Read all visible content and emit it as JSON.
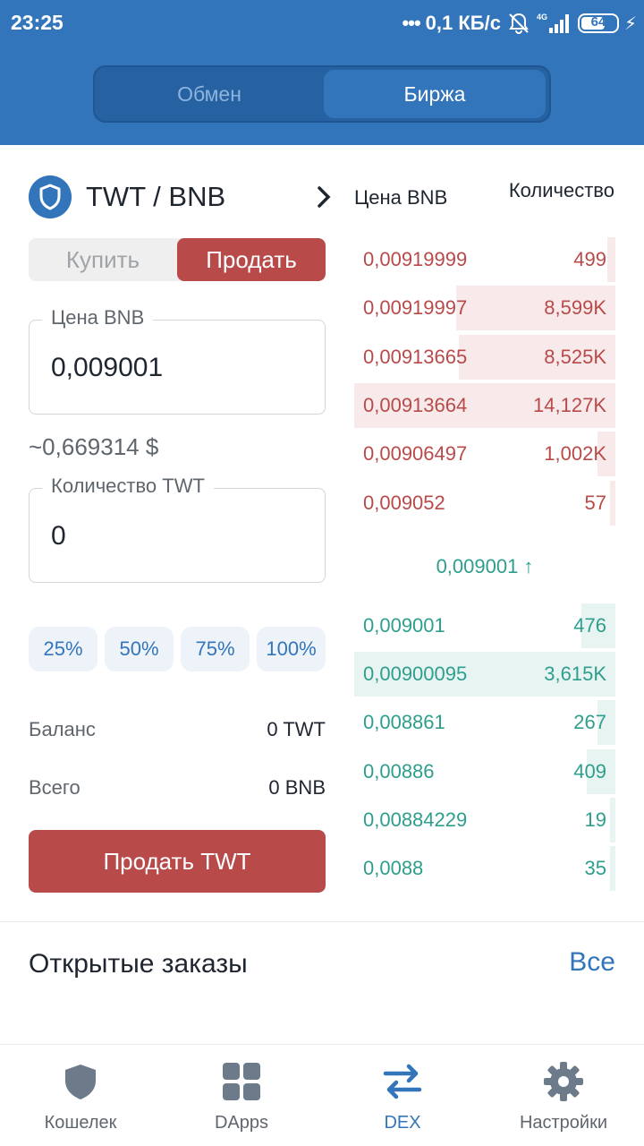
{
  "status_bar": {
    "time": "23:25",
    "network_speed": "0,1 КБ/с",
    "network_type": "4G",
    "battery": "64"
  },
  "header": {
    "tabs": [
      {
        "label": "Обмен",
        "active": false
      },
      {
        "label": "Биржа",
        "active": true
      }
    ]
  },
  "pair": {
    "title": "TWT / BNB",
    "logo_icon": "shield-icon"
  },
  "trade_toggle": {
    "buy_label": "Купить",
    "sell_label": "Продать",
    "selected": "sell"
  },
  "price_field": {
    "label": "Цена BNB",
    "value": "0,009001"
  },
  "usd_estimate": "~0,669314 $",
  "amount_field": {
    "label": "Количество TWT",
    "value": "0"
  },
  "percent_buttons": [
    "25%",
    "50%",
    "75%",
    "100%"
  ],
  "balance": {
    "label": "Баланс",
    "value": "0 TWT"
  },
  "total": {
    "label": "Всего",
    "value": "0 BNB"
  },
  "submit_label": "Продать TWT",
  "order_book": {
    "price_header": "Цена BNB",
    "qty_header": "Количество",
    "asks": [
      {
        "price": "0,00919999",
        "qty": "499",
        "depth": 0.03
      },
      {
        "price": "0,00919997",
        "qty": "8,599K",
        "depth": 0.61
      },
      {
        "price": "0,00913665",
        "qty": "8,525K",
        "depth": 0.6
      },
      {
        "price": "0,00913664",
        "qty": "14,127K",
        "depth": 1.0
      },
      {
        "price": "0,00906497",
        "qty": "1,002K",
        "depth": 0.07
      },
      {
        "price": "0,009052",
        "qty": "57",
        "depth": 0.01
      }
    ],
    "last_price": "0,009001 ↑",
    "bids": [
      {
        "price": "0,009001",
        "qty": "476",
        "depth": 0.13
      },
      {
        "price": "0,00900095",
        "qty": "3,615K",
        "depth": 1.0
      },
      {
        "price": "0,008861",
        "qty": "267",
        "depth": 0.07
      },
      {
        "price": "0,00886",
        "qty": "409",
        "depth": 0.11
      },
      {
        "price": "0,00884229",
        "qty": "19",
        "depth": 0.01
      },
      {
        "price": "0,0088",
        "qty": "35",
        "depth": 0.01
      }
    ]
  },
  "open_orders": {
    "title": "Открытые заказы",
    "all_label": "Все"
  },
  "bottom_nav": [
    {
      "label": "Кошелек",
      "icon": "shield-icon",
      "active": false
    },
    {
      "label": "DApps",
      "icon": "grid-icon",
      "active": false
    },
    {
      "label": "DEX",
      "icon": "swap-arrows-icon",
      "active": true
    },
    {
      "label": "Настройки",
      "icon": "gear-icon",
      "active": false
    }
  ],
  "colors": {
    "primary": "#3375bb",
    "sell": "#b84a4a",
    "buy": "#2e9e8d"
  }
}
